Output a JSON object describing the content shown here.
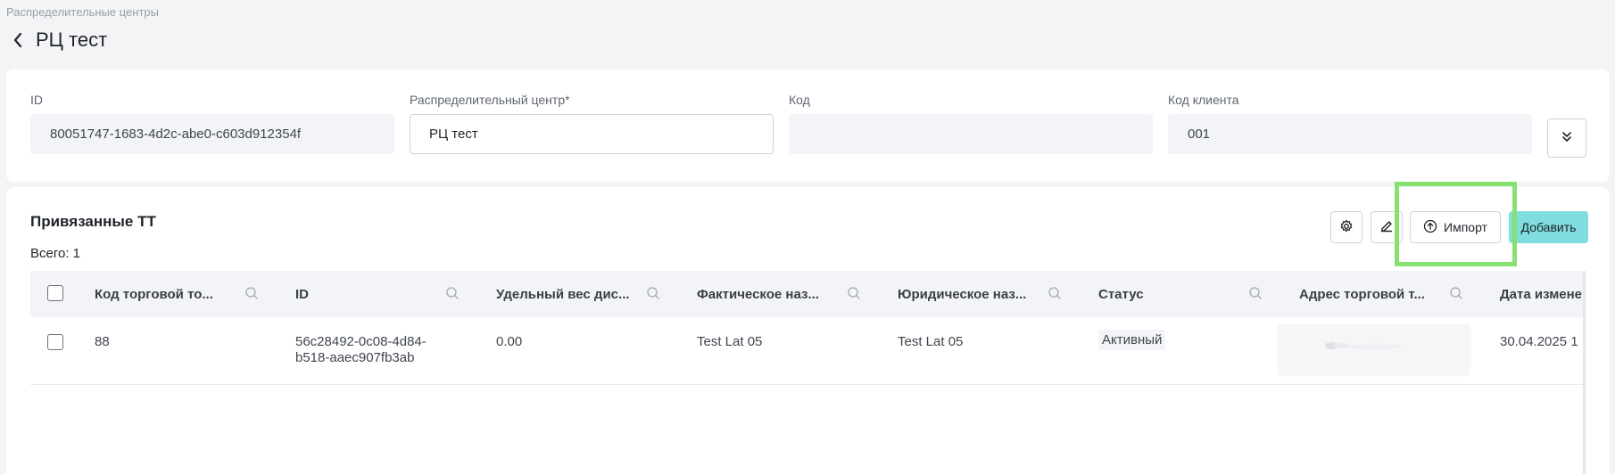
{
  "breadcrumb": "Распределительные центры",
  "page_title": "РЦ тест",
  "fields": [
    {
      "label": "ID",
      "value": "80051747-1683-4d2c-abe0-c603d912354f"
    },
    {
      "label": "Распределительный центр*",
      "value": "РЦ тест"
    },
    {
      "label": "Код",
      "value": ""
    },
    {
      "label": "Код клиента",
      "value": "001"
    }
  ],
  "section": {
    "title": "Привязанные ТТ",
    "total": "Всего: 1"
  },
  "toolbar": {
    "import_label": "Импорт",
    "add_label": "Добавить"
  },
  "table": {
    "columns": [
      "Код торговой то...",
      "ID",
      "Удельный вес дис...",
      "Фактическое наз...",
      "Юридическое наз...",
      "Статус",
      "Адрес торговой т...",
      "Дата измене"
    ],
    "rows": [
      {
        "code": "88",
        "id_line1": "56c28492-0c08-4d84-",
        "id_line2": "b518-aaec907fb3ab",
        "weight": "0.00",
        "actual_name": "Test Lat 05",
        "legal_name": "Test Lat 05",
        "status": "Активный",
        "address": "",
        "date": "30.04.2025 1"
      }
    ]
  },
  "colors": {
    "accent": "#7fdcdf",
    "highlight": "#85e26f",
    "background": "#f3f4f6"
  }
}
